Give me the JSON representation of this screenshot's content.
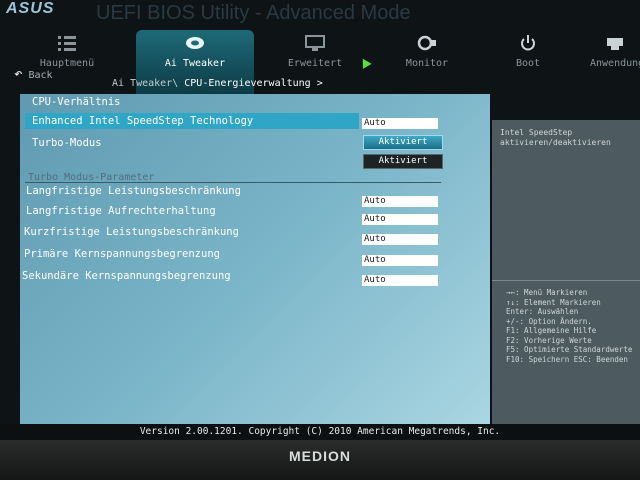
{
  "header": {
    "logo": "ASUS",
    "title": "UEFI BIOS Utility - Advanced Mode"
  },
  "nav": [
    {
      "label": "Hauptmenü",
      "icon": "menu-icon"
    },
    {
      "label": "Ai Tweaker",
      "icon": "tweaker-icon"
    },
    {
      "label": "Erweitert",
      "icon": "advanced-icon"
    },
    {
      "label": "Monitor",
      "icon": "monitor-icon"
    },
    {
      "label": "Boot",
      "icon": "power-icon"
    },
    {
      "label": "Anwendung",
      "icon": "tool-icon"
    }
  ],
  "back_label": "Back",
  "breadcrumb": {
    "parent": "Ai Tweaker\\",
    "current": "CPU-Energieverwaltung >"
  },
  "main": {
    "heading": "CPU-Verhältnis",
    "speedstep_label": "Enhanced Intel SpeedStep Technology",
    "speedstep_value": "Auto",
    "turbo_label": "Turbo-Modus",
    "turbo_option_selected": "Aktiviert",
    "turbo_option_other": "Aktiviert",
    "section_title": "Turbo Modus-Parameter",
    "params": [
      {
        "label": "Langfristige Leistungsbeschränkung",
        "value": "Auto"
      },
      {
        "label": "Langfristige Aufrechterhaltung",
        "value": "Auto"
      },
      {
        "label": "Kurzfristige Leistungsbeschränkung",
        "value": "Auto"
      },
      {
        "label": "Primäre Kernspannungsbegrenzung",
        "value": "Auto"
      },
      {
        "label": "Sekundäre Kernspannungsbegrenzung",
        "value": "Auto"
      }
    ]
  },
  "help": {
    "line1": "Intel SpeedStep",
    "line2": "aktivieren/deaktivieren"
  },
  "keys": [
    "→←: Menü Markieren",
    "↑↓: Element Markieren",
    "Enter: Auswählen",
    "+/-: Option Ändern.",
    "F1: Allgemeine Hilfe",
    "F2: Vorherige Werte",
    "F5: Optimierte Standardwerte",
    "F10: Speichern  ESC: Beenden"
  ],
  "footer": "Version 2.00.1201. Copyright (C) 2010 American Megatrends, Inc.",
  "brand": "MEDION",
  "colors": {
    "accent": "#2fa6c6",
    "panel": "#7ab4c8",
    "sidebar": "#4d5a5f",
    "cursor": "#5bdc3c"
  }
}
